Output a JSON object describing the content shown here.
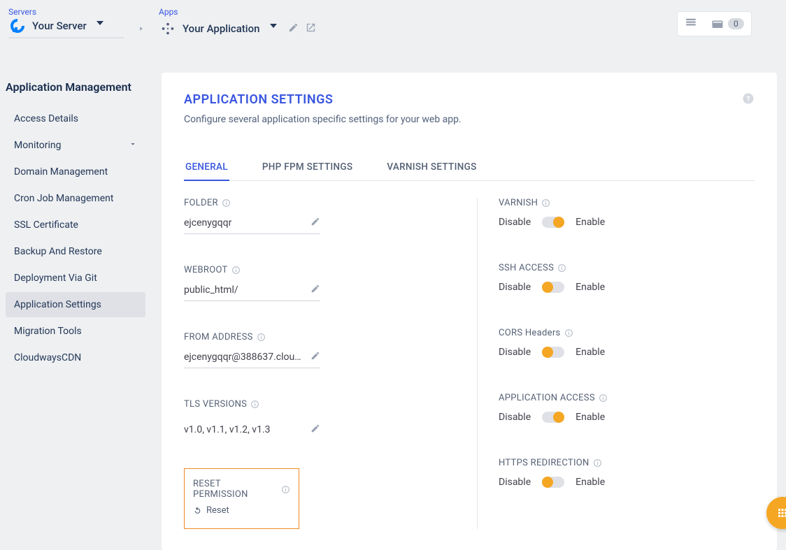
{
  "breadcrumb": {
    "servers_label": "Servers",
    "server_name": "Your Server",
    "apps_label": "Apps",
    "app_name": "Your Application"
  },
  "topbar": {
    "count": "0"
  },
  "sidebar": {
    "title": "Application Management",
    "items": [
      {
        "label": "Access Details"
      },
      {
        "label": "Monitoring",
        "expandable": true
      },
      {
        "label": "Domain Management"
      },
      {
        "label": "Cron Job Management"
      },
      {
        "label": "SSL Certificate"
      },
      {
        "label": "Backup And Restore"
      },
      {
        "label": "Deployment Via Git"
      },
      {
        "label": "Application Settings",
        "active": true
      },
      {
        "label": "Migration Tools"
      },
      {
        "label": "CloudwaysCDN"
      }
    ]
  },
  "card": {
    "title": "APPLICATION SETTINGS",
    "subtitle": "Configure several application specific settings for your web app."
  },
  "tabs": [
    {
      "label": "GENERAL",
      "active": true
    },
    {
      "label": "PHP FPM SETTINGS"
    },
    {
      "label": "VARNISH SETTINGS"
    }
  ],
  "left_fields": {
    "folder": {
      "label": "FOLDER",
      "value": "ejcenygqqr"
    },
    "webroot": {
      "label": "WEBROOT",
      "value": "public_html/"
    },
    "from": {
      "label": "FROM ADDRESS",
      "value": "ejcenygqqr@388637.clou…"
    },
    "tls": {
      "label": "TLS VERSIONS",
      "value": "v1.0, v1.1, v1.2, v1.3"
    },
    "reset": {
      "label": "RESET PERMISSION",
      "action": "Reset"
    }
  },
  "right_fields": [
    {
      "label": "VARNISH",
      "state": "on"
    },
    {
      "label": "SSH ACCESS",
      "state": "off"
    },
    {
      "label": "CORS Headers",
      "state": "off"
    },
    {
      "label": "APPLICATION ACCESS",
      "state": "on"
    },
    {
      "label": "HTTPS REDIRECTION",
      "state": "off"
    }
  ],
  "toggle_labels": {
    "disable": "Disable",
    "enable": "Enable"
  }
}
